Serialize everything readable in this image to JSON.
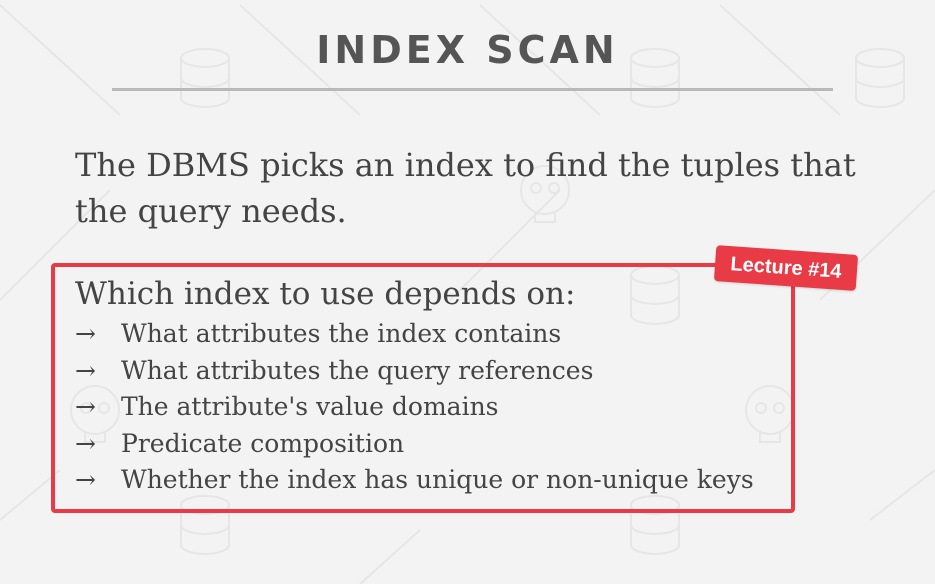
{
  "slide": {
    "title": "INDEX SCAN",
    "intro": "The DBMS picks an index to find the tuples that the query needs.",
    "box": {
      "heading": "Which index to use depends on:",
      "arrow": "→",
      "items": [
        "What attributes the index contains",
        "What attributes the query references",
        "The attribute's value domains",
        "Predicate composition",
        "Whether the index has unique or non-unique keys"
      ]
    },
    "badge": "Lecture #14"
  },
  "colors": {
    "accent": "#e93b45",
    "title": "#555555",
    "text": "#444444",
    "background": "#f3f3f3"
  }
}
